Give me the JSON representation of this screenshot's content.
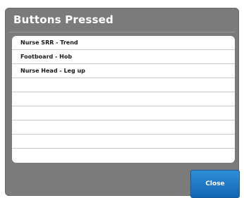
{
  "dialog": {
    "title": "Buttons Pressed",
    "close_label": "Close"
  },
  "list": {
    "rows": [
      "Nurse SRR - Trend",
      "Footboard - Hob",
      "Nurse Head - Leg up",
      "",
      "",
      "",
      "",
      "",
      ""
    ]
  }
}
